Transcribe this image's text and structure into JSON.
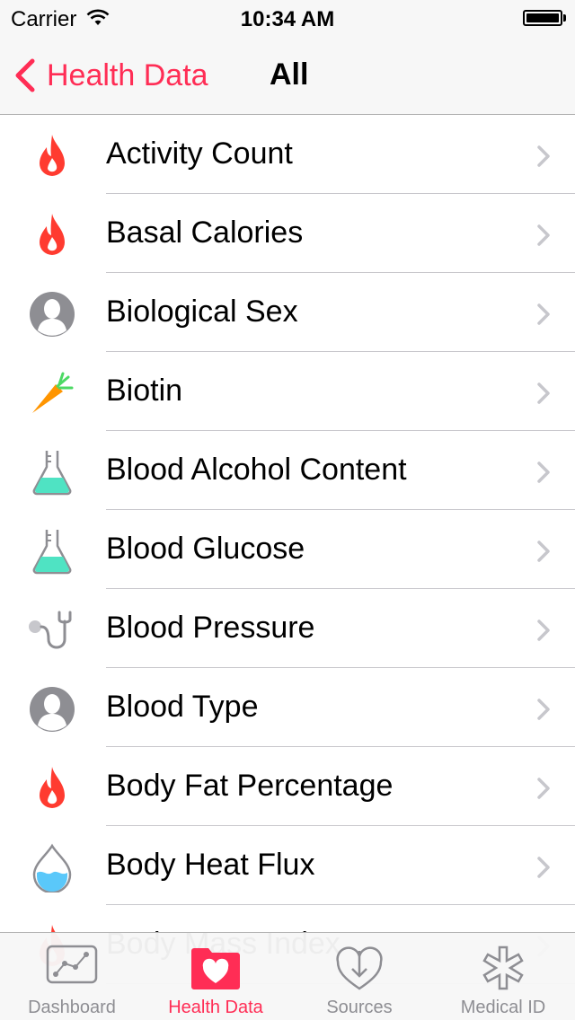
{
  "status_bar": {
    "carrier": "Carrier",
    "time": "10:34 AM"
  },
  "nav": {
    "back_label": "Health Data",
    "title": "All"
  },
  "items": [
    {
      "label": "Activity Count",
      "icon": "flame-icon"
    },
    {
      "label": "Basal Calories",
      "icon": "flame-icon"
    },
    {
      "label": "Biological Sex",
      "icon": "person-icon"
    },
    {
      "label": "Biotin",
      "icon": "carrot-icon"
    },
    {
      "label": "Blood Alcohol Content",
      "icon": "flask-icon"
    },
    {
      "label": "Blood Glucose",
      "icon": "flask-icon"
    },
    {
      "label": "Blood Pressure",
      "icon": "stethoscope-icon"
    },
    {
      "label": "Blood Type",
      "icon": "person-icon"
    },
    {
      "label": "Body Fat Percentage",
      "icon": "flame-icon"
    },
    {
      "label": "Body Heat Flux",
      "icon": "water-drop-icon"
    },
    {
      "label": "Body Mass Index",
      "icon": "flame-icon"
    }
  ],
  "tabs": [
    {
      "label": "Dashboard",
      "icon": "dashboard-chart-icon",
      "active": false
    },
    {
      "label": "Health Data",
      "icon": "health-folder-icon",
      "active": true
    },
    {
      "label": "Sources",
      "icon": "sources-heart-icon",
      "active": false
    },
    {
      "label": "Medical ID",
      "icon": "medical-star-icon",
      "active": false
    }
  ],
  "colors": {
    "accent": "#ff2d55",
    "flame": "#ff3b30",
    "flask": "#4fe3c3",
    "carrot": "#ff9500",
    "water": "#5ac8fa",
    "gray": "#8e8e93"
  }
}
